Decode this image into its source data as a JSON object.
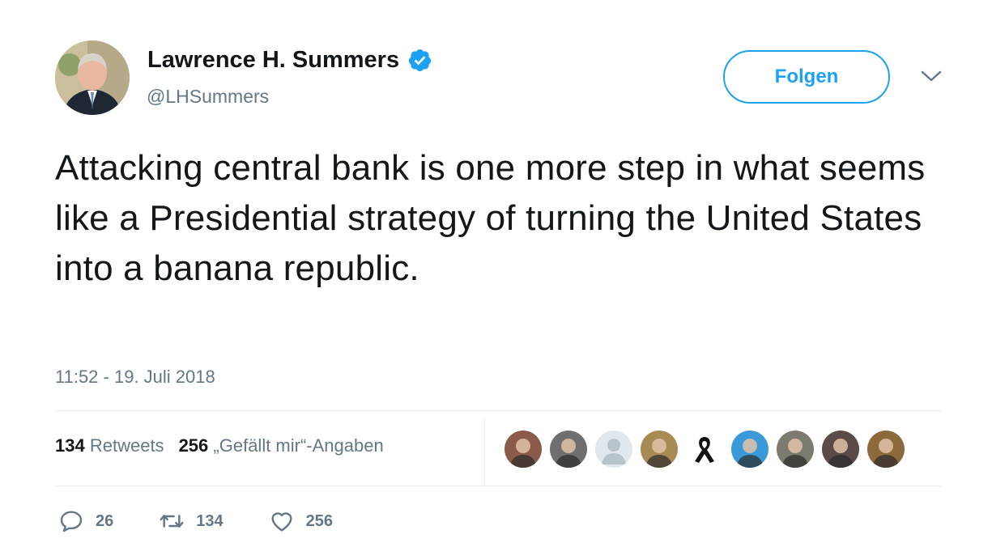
{
  "author": {
    "name": "Lawrence H. Summers",
    "handle": "@LHSummers",
    "verified": true
  },
  "follow_button": {
    "label": "Folgen"
  },
  "tweet": {
    "text": "Attacking central bank is one more step in what seems like a Presidential strategy of turning the United States into a banana republic.",
    "timestamp": "11:52 - 19. Juli 2018"
  },
  "stats": {
    "retweets_count": "134",
    "retweets_label": "Retweets",
    "likes_count": "256",
    "likes_label": "„Gefällt mir“-Angaben"
  },
  "likers": [
    {
      "icon": "user-avatar",
      "color": "#8a5a4a"
    },
    {
      "icon": "user-avatar",
      "color": "#6f6f6f"
    },
    {
      "icon": "default-avatar",
      "color": "#b8c4cc"
    },
    {
      "icon": "user-avatar",
      "color": "#a88a55"
    },
    {
      "icon": "black-ribbon",
      "color": "#111111"
    },
    {
      "icon": "user-avatar",
      "color": "#3a9ad9"
    },
    {
      "icon": "user-avatar",
      "color": "#7d7a70"
    },
    {
      "icon": "user-avatar",
      "color": "#5a4a48"
    },
    {
      "icon": "user-avatar",
      "color": "#8c6a3c"
    }
  ],
  "actions": {
    "replies": "26",
    "retweets": "134",
    "likes": "256"
  },
  "colors": {
    "accent": "#1da1f2",
    "text_primary": "#14171a",
    "text_secondary": "#657786",
    "divider": "#e6ecf0"
  }
}
